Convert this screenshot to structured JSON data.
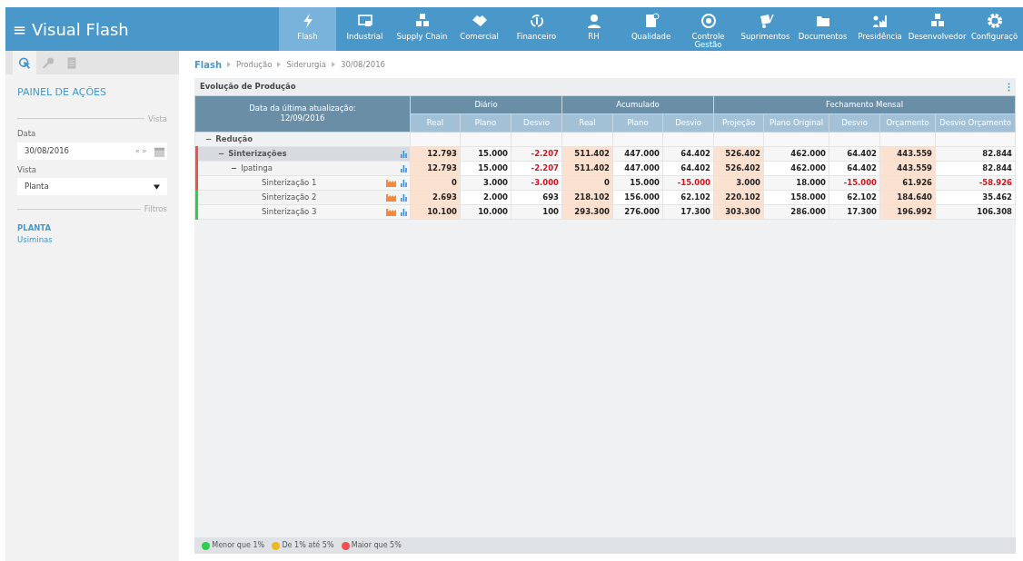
{
  "app": {
    "title": "Visual Flash",
    "menu_icon": "≡"
  },
  "nav": [
    {
      "label": "Flash",
      "selected": true
    },
    {
      "label": "Industrial",
      "selected": false
    },
    {
      "label": "Supply Chain",
      "selected": false
    },
    {
      "label": "Comercial",
      "selected": false
    },
    {
      "label": "Financeiro",
      "selected": false
    },
    {
      "label": "RH",
      "selected": false
    },
    {
      "label": "Qualidade",
      "selected": false
    },
    {
      "label": "Controle Gestão",
      "selected": false
    },
    {
      "label": "Suprimentos",
      "selected": false
    },
    {
      "label": "Documentos",
      "selected": false
    },
    {
      "label": "Presidência",
      "selected": false
    },
    {
      "label": "Desenvolvedor",
      "selected": false
    },
    {
      "label": "Configuraçõ",
      "selected": false
    }
  ],
  "sidebar": {
    "tabs": [
      {
        "selected": true
      },
      {
        "selected": false
      },
      {
        "selected": false
      }
    ],
    "title": "PAINEL DE AÇÕES",
    "section_1": "Vista",
    "date_label": "Data",
    "date_value": "30/08/2016",
    "prev": "«",
    "next": "»",
    "view_label": "Vista",
    "view_value": "Planta",
    "section_2": "Filtros",
    "filter_name": "PLANTA",
    "filter_value": "Usiminas"
  },
  "breadcrumb": [
    "Flash",
    "Produção",
    "Siderurgia",
    "30/08/2016"
  ],
  "panel": {
    "title": "Evolução de Produção",
    "update_label": "Data da última atualização:",
    "update_date": "12/09/2016",
    "groups": [
      {
        "label": "Diário"
      },
      {
        "label": "Acumulado"
      },
      {
        "label": "Fechamento Mensal"
      }
    ],
    "columns": [
      {
        "label": "Real",
        "highlight": true
      },
      {
        "label": "Plano",
        "highlight": false
      },
      {
        "label": "Desvio",
        "highlight": false
      },
      {
        "label": "Real",
        "highlight": true
      },
      {
        "label": "Plano",
        "highlight": false
      },
      {
        "label": "Desvio",
        "highlight": false
      },
      {
        "label": "Projeção",
        "highlight": true
      },
      {
        "label": "Plano Original",
        "highlight": false
      },
      {
        "label": "Desvio",
        "highlight": false
      },
      {
        "label": "Orçamento",
        "highlight": true
      },
      {
        "label": "Desvio Orçamento",
        "highlight": false
      }
    ],
    "rows": [
      {
        "label": "Redução",
        "toggle": "−",
        "expanded": true,
        "children": [
          {
            "label": "Sinterizações",
            "toggle": "−",
            "expanded": true,
            "color": "#f0504f",
            "factory": false,
            "chart": true,
            "values": [
              "12.793",
              "15.000",
              "-2.207",
              "511.402",
              "447.000",
              "64.402",
              "526.402",
              "462.000",
              "64.402",
              "443.559",
              "82.844"
            ],
            "children": [
              {
                "label": "Ipatinga",
                "toggle": "−",
                "expanded": true,
                "color": "#f0504f",
                "factory": false,
                "chart": true,
                "values": [
                  "12.793",
                  "15.000",
                  "-2.207",
                  "511.402",
                  "447.000",
                  "64.402",
                  "526.402",
                  "462.000",
                  "64.402",
                  "443.559",
                  "82.844"
                ],
                "children": [
                  {
                    "label": "Sinterização 1",
                    "color": "#f0504f",
                    "factory": true,
                    "chart": true,
                    "values": [
                      "0",
                      "3.000",
                      "-3.000",
                      "0",
                      "15.000",
                      "-15.000",
                      "3.000",
                      "18.000",
                      "-15.000",
                      "61.926",
                      "-58.926"
                    ]
                  },
                  {
                    "label": "Sinterização 2",
                    "color": "#2ecc4f",
                    "factory": true,
                    "chart": true,
                    "values": [
                      "2.693",
                      "2.000",
                      "693",
                      "218.102",
                      "156.000",
                      "62.102",
                      "220.102",
                      "158.000",
                      "62.102",
                      "184.640",
                      "35.462"
                    ]
                  },
                  {
                    "label": "Sinterização 3",
                    "color": "#2ecc4f",
                    "factory": true,
                    "chart": true,
                    "values": [
                      "10.100",
                      "10.000",
                      "100",
                      "293.300",
                      "276.000",
                      "17.300",
                      "303.300",
                      "286.000",
                      "17.300",
                      "196.992",
                      "106.308"
                    ]
                  }
                ]
              }
            ]
          }
        ]
      }
    ],
    "legend": [
      {
        "label": "Menor que 1%",
        "color": "#2ecc4f"
      },
      {
        "label": "De 1% até 5%",
        "color": "#f0b51f"
      },
      {
        "label": "Maior que 5%",
        "color": "#f0504f"
      }
    ]
  }
}
